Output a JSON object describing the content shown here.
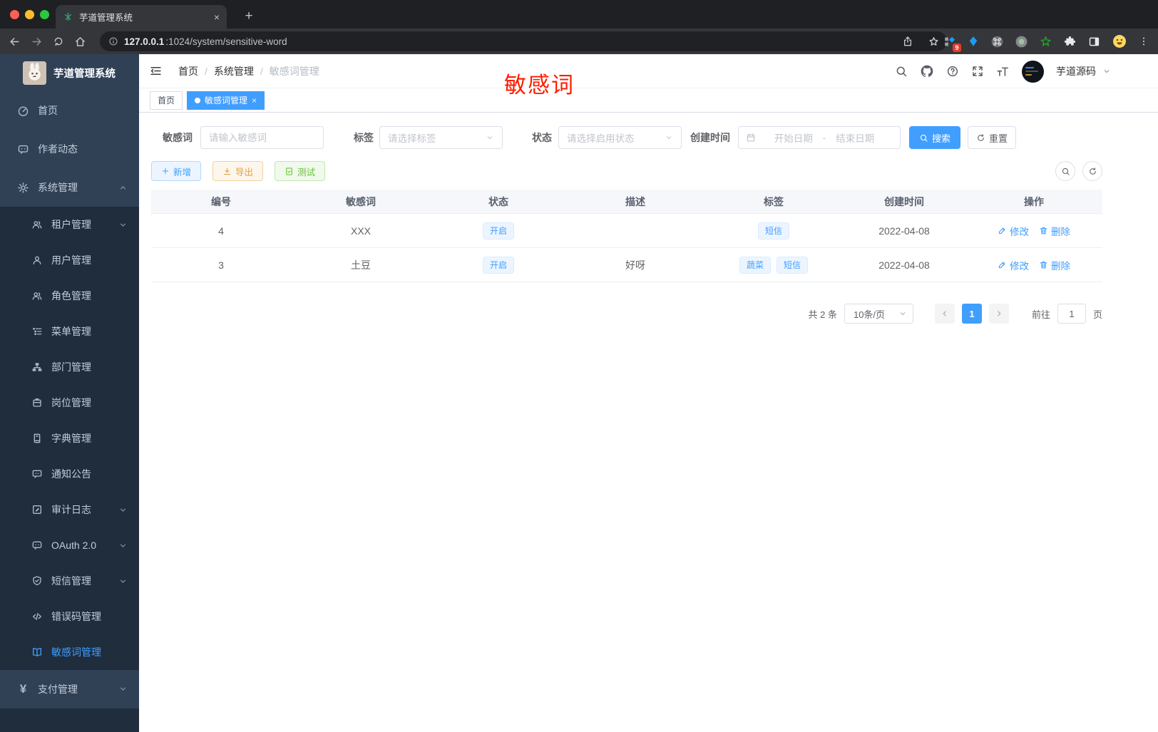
{
  "colors": {
    "primary": "#409eff",
    "overlay_red": "#fe1c00"
  },
  "browser": {
    "tab_title": "芋道管理系统",
    "close_glyph": "×",
    "newtab_glyph": "+",
    "url_host": "127.0.0.1",
    "url_path": ":1024/system/sensitive-word",
    "ext_badge": "9"
  },
  "sidebar": {
    "logo_title": "芋道管理系统",
    "yen_glyph": "¥",
    "items": [
      {
        "label": "首页"
      },
      {
        "label": "作者动态"
      },
      {
        "label": "系统管理"
      },
      {
        "label": "租户管理"
      },
      {
        "label": "用户管理"
      },
      {
        "label": "角色管理"
      },
      {
        "label": "菜单管理"
      },
      {
        "label": "部门管理"
      },
      {
        "label": "岗位管理"
      },
      {
        "label": "字典管理"
      },
      {
        "label": "通知公告"
      },
      {
        "label": "审计日志"
      },
      {
        "label": "OAuth 2.0"
      },
      {
        "label": "短信管理"
      },
      {
        "label": "错误码管理"
      },
      {
        "label": "敏感词管理"
      },
      {
        "label": "支付管理"
      }
    ]
  },
  "header": {
    "breadcrumb": [
      "首页",
      "系统管理",
      "敏感词管理"
    ],
    "breadcrumb_sep": "/",
    "overlay_text": "敏感词",
    "user_name": "芋道源码"
  },
  "tabsbar": {
    "tabs": [
      {
        "label": "首页"
      },
      {
        "label": "敏感词管理"
      }
    ],
    "close_glyph": "×"
  },
  "filters": {
    "keyword_label": "敏感词",
    "keyword_placeholder": "请输入敏感词",
    "tag_label": "标签",
    "tag_placeholder": "请选择标签",
    "status_label": "状态",
    "status_placeholder": "请选择启用状态",
    "date_label": "创建时间",
    "date_start_placeholder": "开始日期",
    "date_sep": "-",
    "date_end_placeholder": "结束日期",
    "search_label": "搜索",
    "reset_label": "重置"
  },
  "toolbar": {
    "add_label": "新增",
    "export_label": "导出",
    "test_label": "测试"
  },
  "table": {
    "columns": [
      "编号",
      "敏感词",
      "状态",
      "描述",
      "标签",
      "创建时间",
      "操作"
    ],
    "edit_label": "修改",
    "delete_label": "删除",
    "rows": [
      {
        "id": "4",
        "word": "XXX",
        "status": "开启",
        "description": "",
        "tags": [
          "短信"
        ],
        "create_time": "2022-04-08"
      },
      {
        "id": "3",
        "word": "土豆",
        "status": "开启",
        "description": "好呀",
        "tags": [
          "蔬菜",
          "短信"
        ],
        "create_time": "2022-04-08"
      }
    ]
  },
  "pagination": {
    "total_text": "共 2 条",
    "page_size": "10条/页",
    "current_page": "1",
    "goto_label": "前往",
    "goto_value": "1",
    "page_unit": "页"
  }
}
